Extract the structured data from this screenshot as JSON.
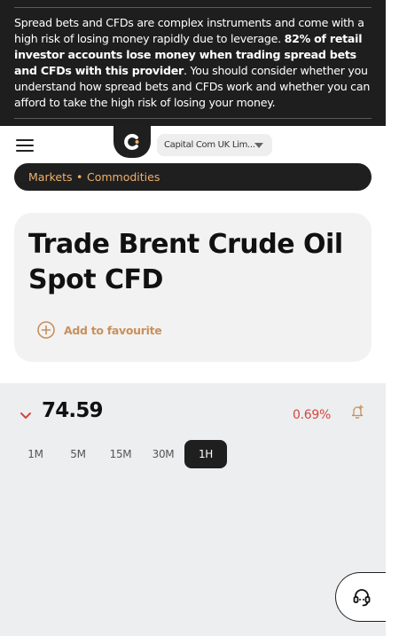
{
  "risk_warning": {
    "text_before": "Spread bets and CFDs are complex instruments and come with a high risk of losing money rapidly due to leverage. ",
    "text_bold": "82% of retail investor accounts lose money when trading spread bets and CFDs with this provider",
    "text_after": ". You should consider whether you understand how spread bets and CFDs work and whether you can afford to take the high risk of losing your money."
  },
  "header": {
    "menu_icon": "hamburger-menu-icon",
    "logo_icon": "capital-com-logo",
    "entity_selector": "Capital Com UK Lim..."
  },
  "breadcrumb": {
    "items": [
      "Markets",
      "Commodities"
    ],
    "separator": "•"
  },
  "instrument": {
    "title": "Trade Brent Crude Oil Spot CFD",
    "favourite_label": "Add to favourite"
  },
  "quote": {
    "direction": "down",
    "price": "74.59",
    "change": "0.69%",
    "alert_icon": "bell-plus-icon"
  },
  "timeframes": {
    "options": [
      "1M",
      "5M",
      "15M",
      "30M",
      "1H"
    ],
    "selected": "1H"
  },
  "support": {
    "icon": "headset-icon"
  },
  "colors": {
    "dark": "#1f1f1f",
    "accent": "#c8905c",
    "negative": "#d6453f",
    "panel": "#eceeef"
  }
}
